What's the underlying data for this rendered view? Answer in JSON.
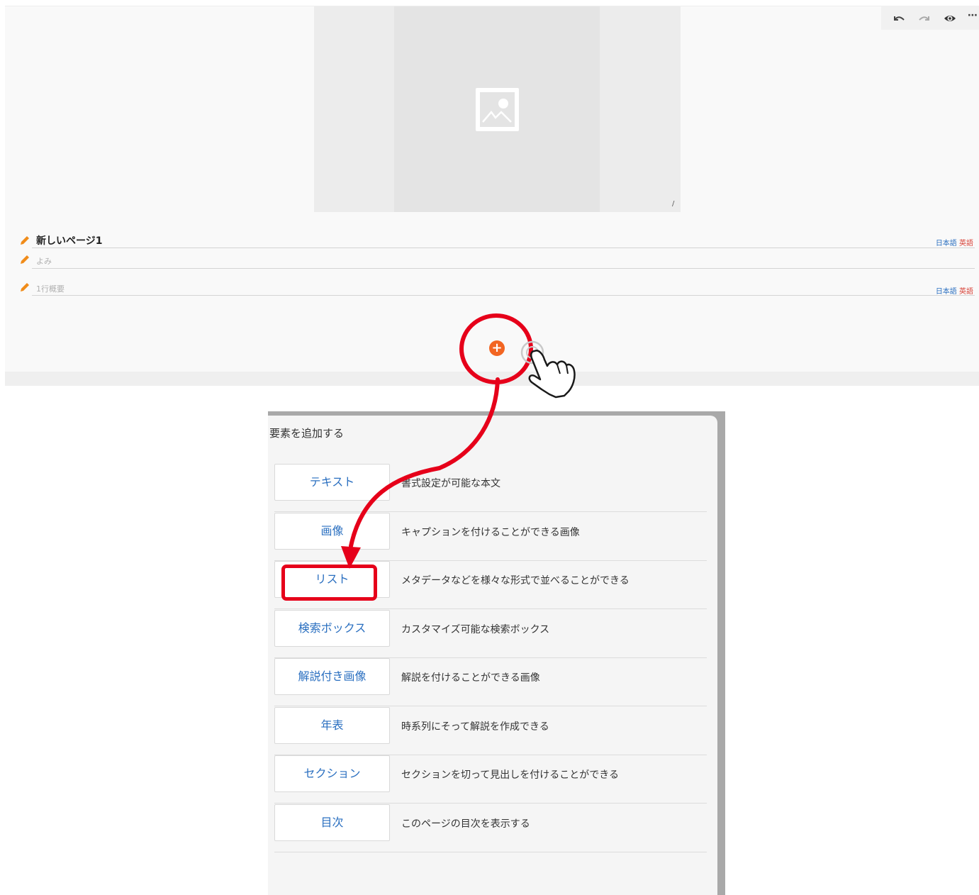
{
  "toolbar": {
    "undo_icon": "undo-icon",
    "redo_icon": "redo-icon",
    "preview_icon": "eye-icon",
    "more_icon": "more-icon",
    "more_label": "⋯"
  },
  "hero": {
    "placeholder_icon": "image-placeholder-icon",
    "caption": "/"
  },
  "page": {
    "title": "新しいページ1",
    "reading_placeholder": "よみ",
    "summary_placeholder": "1行概要",
    "lang_ja": "日本語",
    "lang_en": "英語"
  },
  "add_button": {
    "label": "+"
  },
  "dialog": {
    "title": "要素を追加する",
    "elements": [
      {
        "label": "テキスト",
        "desc": "書式設定が可能な本文"
      },
      {
        "label": "画像",
        "desc": "キャプションを付けることができる画像"
      },
      {
        "label": "リスト",
        "desc": "メタデータなどを様々な形式で並べることができる"
      },
      {
        "label": "検索ボックス",
        "desc": "カスタマイズ可能な検索ボックス"
      },
      {
        "label": "解説付き画像",
        "desc": "解説を付けることができる画像"
      },
      {
        "label": "年表",
        "desc": "時系列にそって解説を作成できる"
      },
      {
        "label": "セクション",
        "desc": "セクションを切って見出しを付けることができる"
      },
      {
        "label": "目次",
        "desc": "このページの目次を表示する"
      }
    ]
  },
  "annotations": {
    "highlight_color": "#e6001a",
    "cursor_icon": "hand-pointer-icon",
    "arrow_icon": "curved-arrow-icon"
  },
  "colors": {
    "accent_orange": "#f26522",
    "link_blue": "#2a6fc0",
    "lang_red": "#d8453a"
  }
}
